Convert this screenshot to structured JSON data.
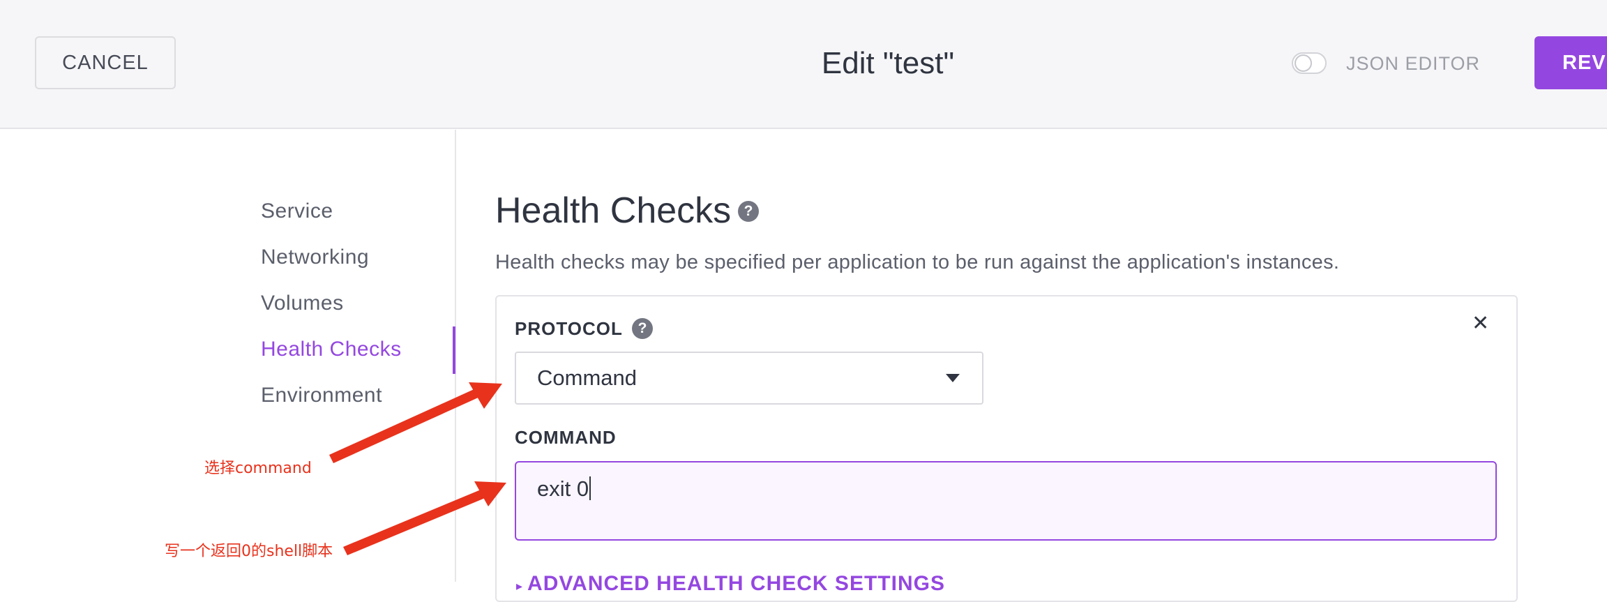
{
  "header": {
    "cancel_label": "CANCEL",
    "title": "Edit \"test\"",
    "json_editor_label": "JSON EDITOR",
    "json_editor_enabled": false,
    "review_label": "REVIEW"
  },
  "sidebar": {
    "items": [
      {
        "label": "Service"
      },
      {
        "label": "Networking"
      },
      {
        "label": "Volumes"
      },
      {
        "label": "Health Checks",
        "active": true
      },
      {
        "label": "Environment"
      }
    ]
  },
  "main": {
    "title": "Health Checks",
    "description": "Health checks may be specified per application to be run against the application's instances.",
    "protocol_label": "PROTOCOL",
    "protocol_value": "Command",
    "command_label": "COMMAND",
    "command_value": "exit 0",
    "advanced_label": "ADVANCED HEALTH CHECK SETTINGS"
  },
  "annotations": {
    "select_command": "选择command",
    "write_script": "写一个返回0的shell脚本"
  },
  "colors": {
    "accent": "#9447e0",
    "header_bg": "#f6f6f8",
    "annotation": "#e8321c",
    "text": "#2f3440"
  },
  "icons": [
    "help-icon",
    "close-icon",
    "chevron-down-icon"
  ]
}
